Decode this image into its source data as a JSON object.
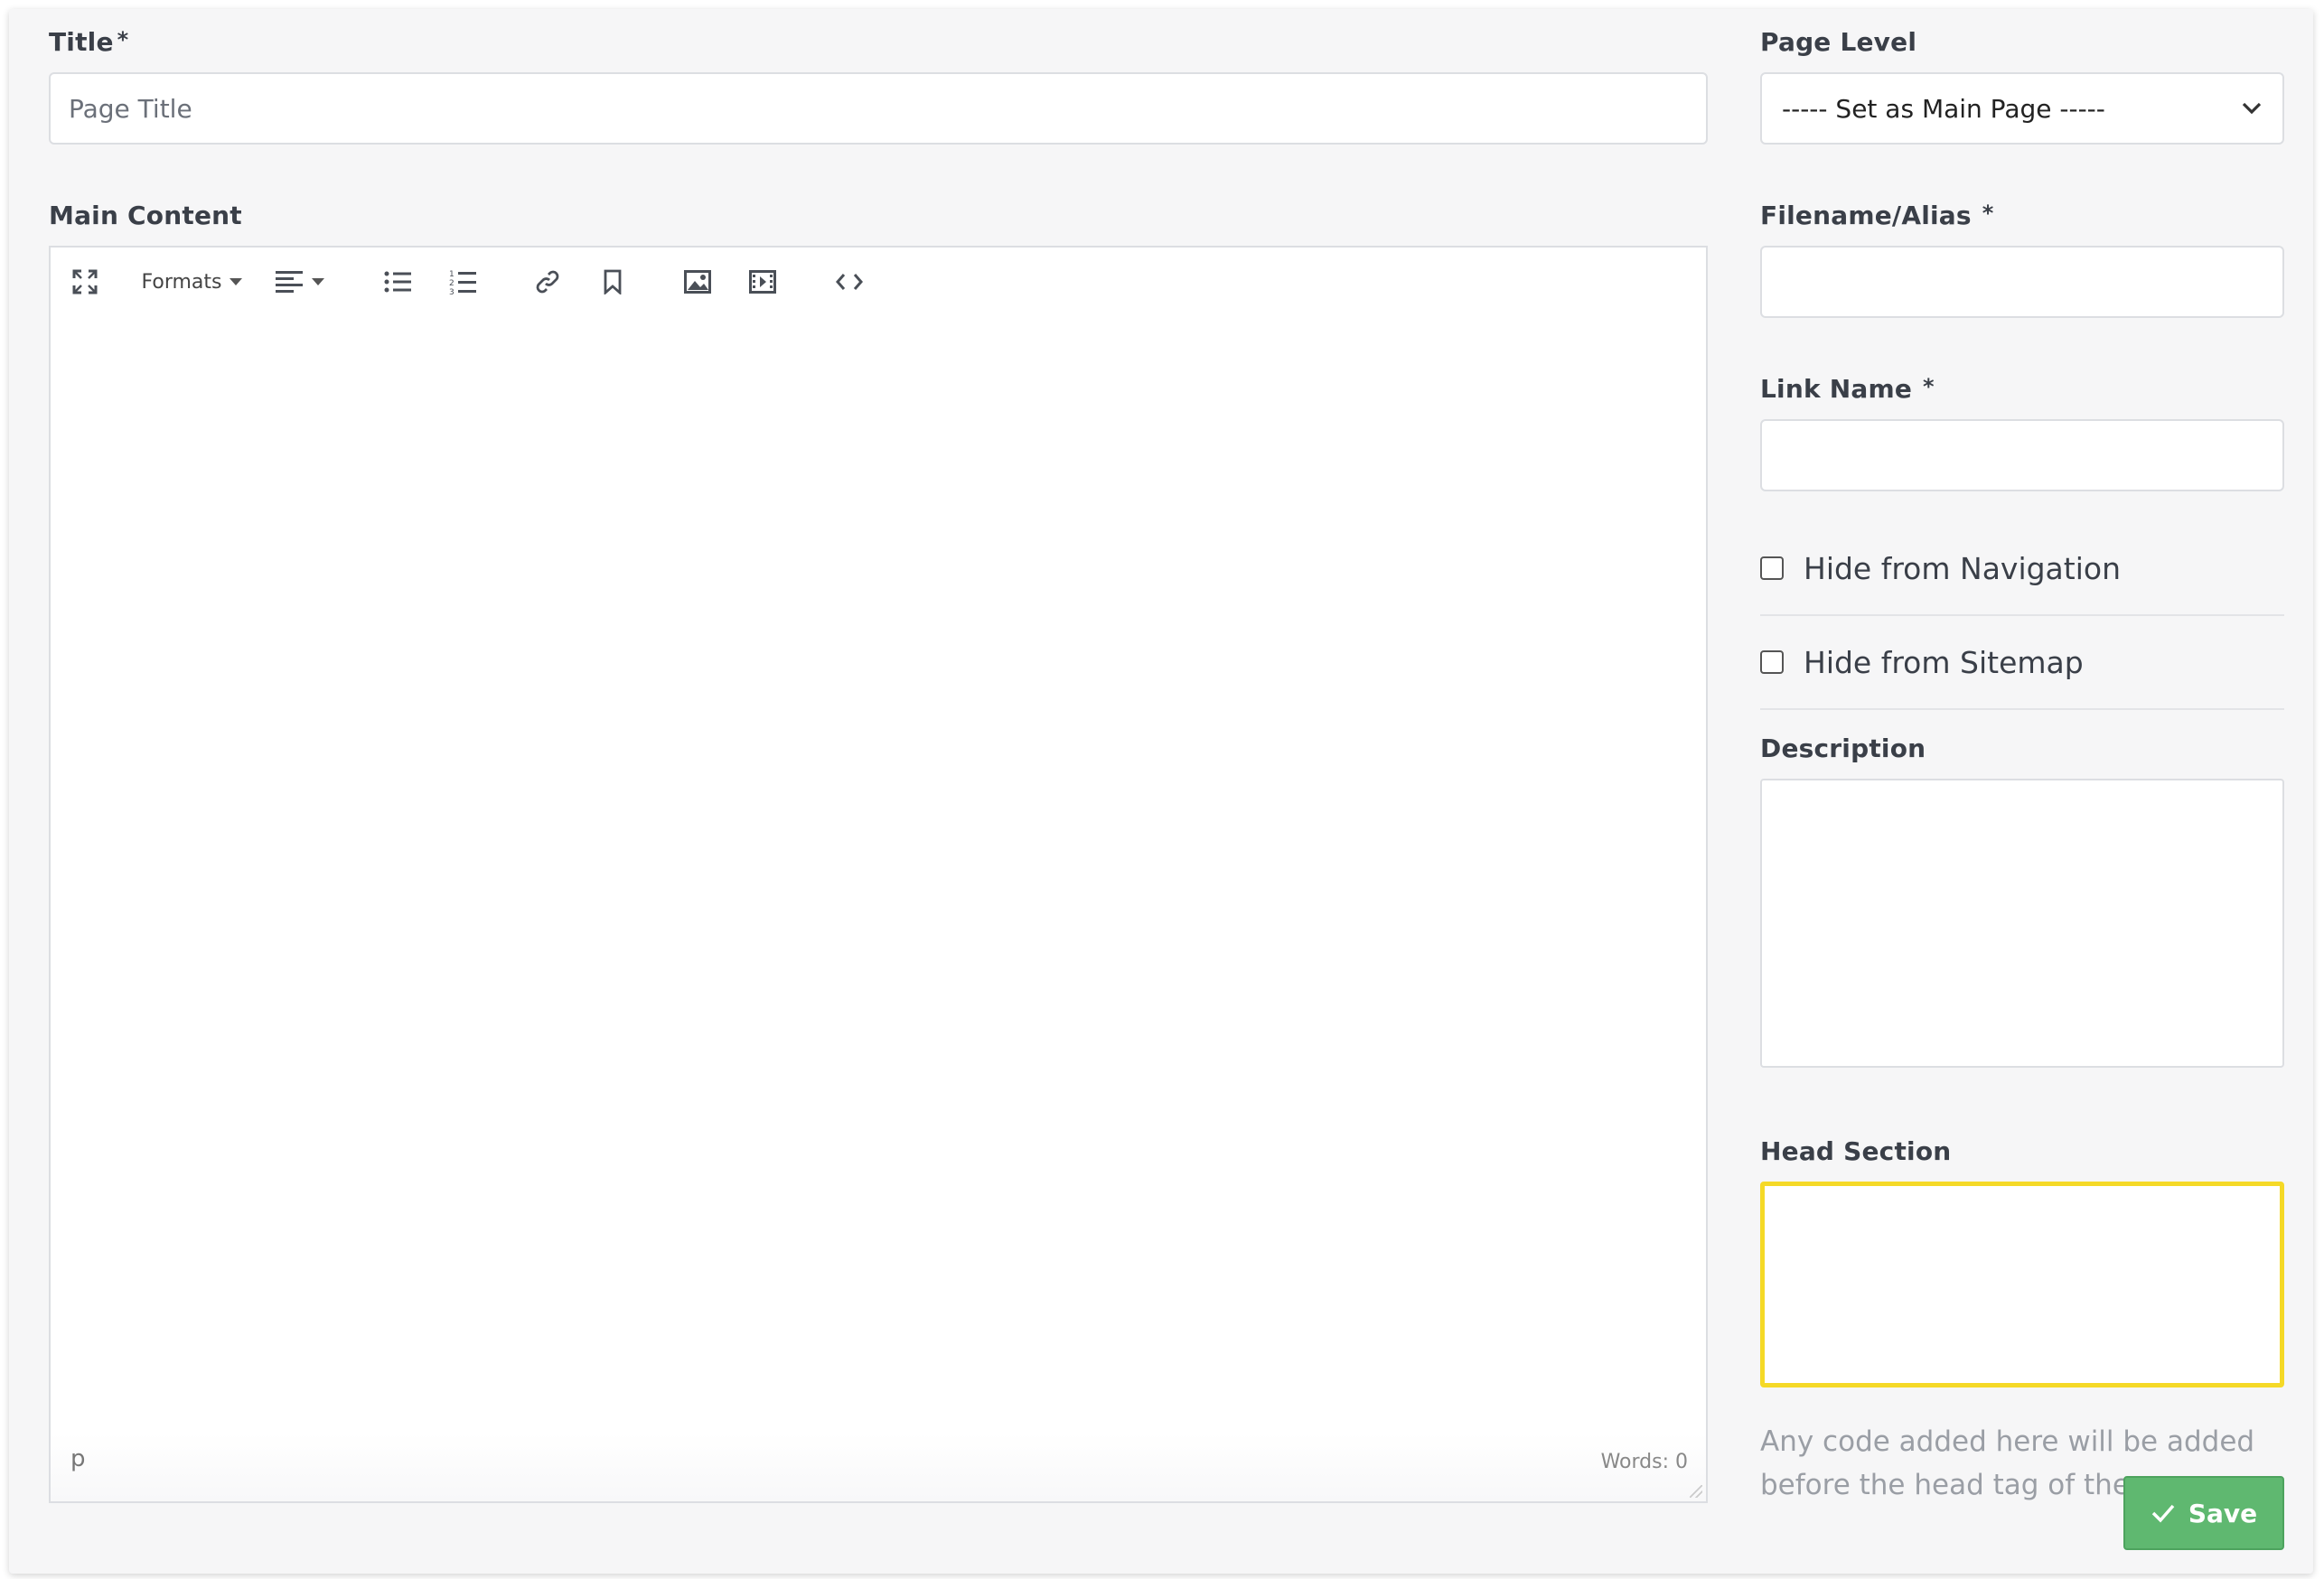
{
  "form": {
    "title_label": "Title",
    "required_mark": "*",
    "title_placeholder": "Page Title",
    "title_value": "",
    "main_content_label": "Main Content",
    "page_level_label": "Page Level",
    "page_level_selected": "----- Set as Main Page -----",
    "filename_label": "Filename/Alias",
    "filename_value": "",
    "link_name_label": "Link Name",
    "link_name_value": "",
    "hide_navigation_label": "Hide from Navigation",
    "hide_navigation_checked": false,
    "hide_sitemap_label": "Hide from Sitemap",
    "hide_sitemap_checked": false,
    "description_label": "Description",
    "description_value": "",
    "head_section_label": "Head Section",
    "head_section_value": "",
    "head_section_help": "Any code added here will be added before the head tag of the page"
  },
  "editor": {
    "toolbar": {
      "fullscreen_icon": "fullscreen-icon",
      "formats_label": "Formats",
      "align_icon": "align-left-icon",
      "bullet_list_icon": "bullet-list-icon",
      "numbered_list_icon": "numbered-list-icon",
      "link_icon": "link-icon",
      "bookmark_icon": "bookmark-icon",
      "image_icon": "image-icon",
      "media_icon": "media-icon",
      "code_icon": "code-icon"
    },
    "status_path": "p",
    "word_count": "Words: 0"
  },
  "actions": {
    "save_label": "Save",
    "save_color": "#5fb870"
  },
  "colors": {
    "head_section_border": "#f5d927"
  }
}
